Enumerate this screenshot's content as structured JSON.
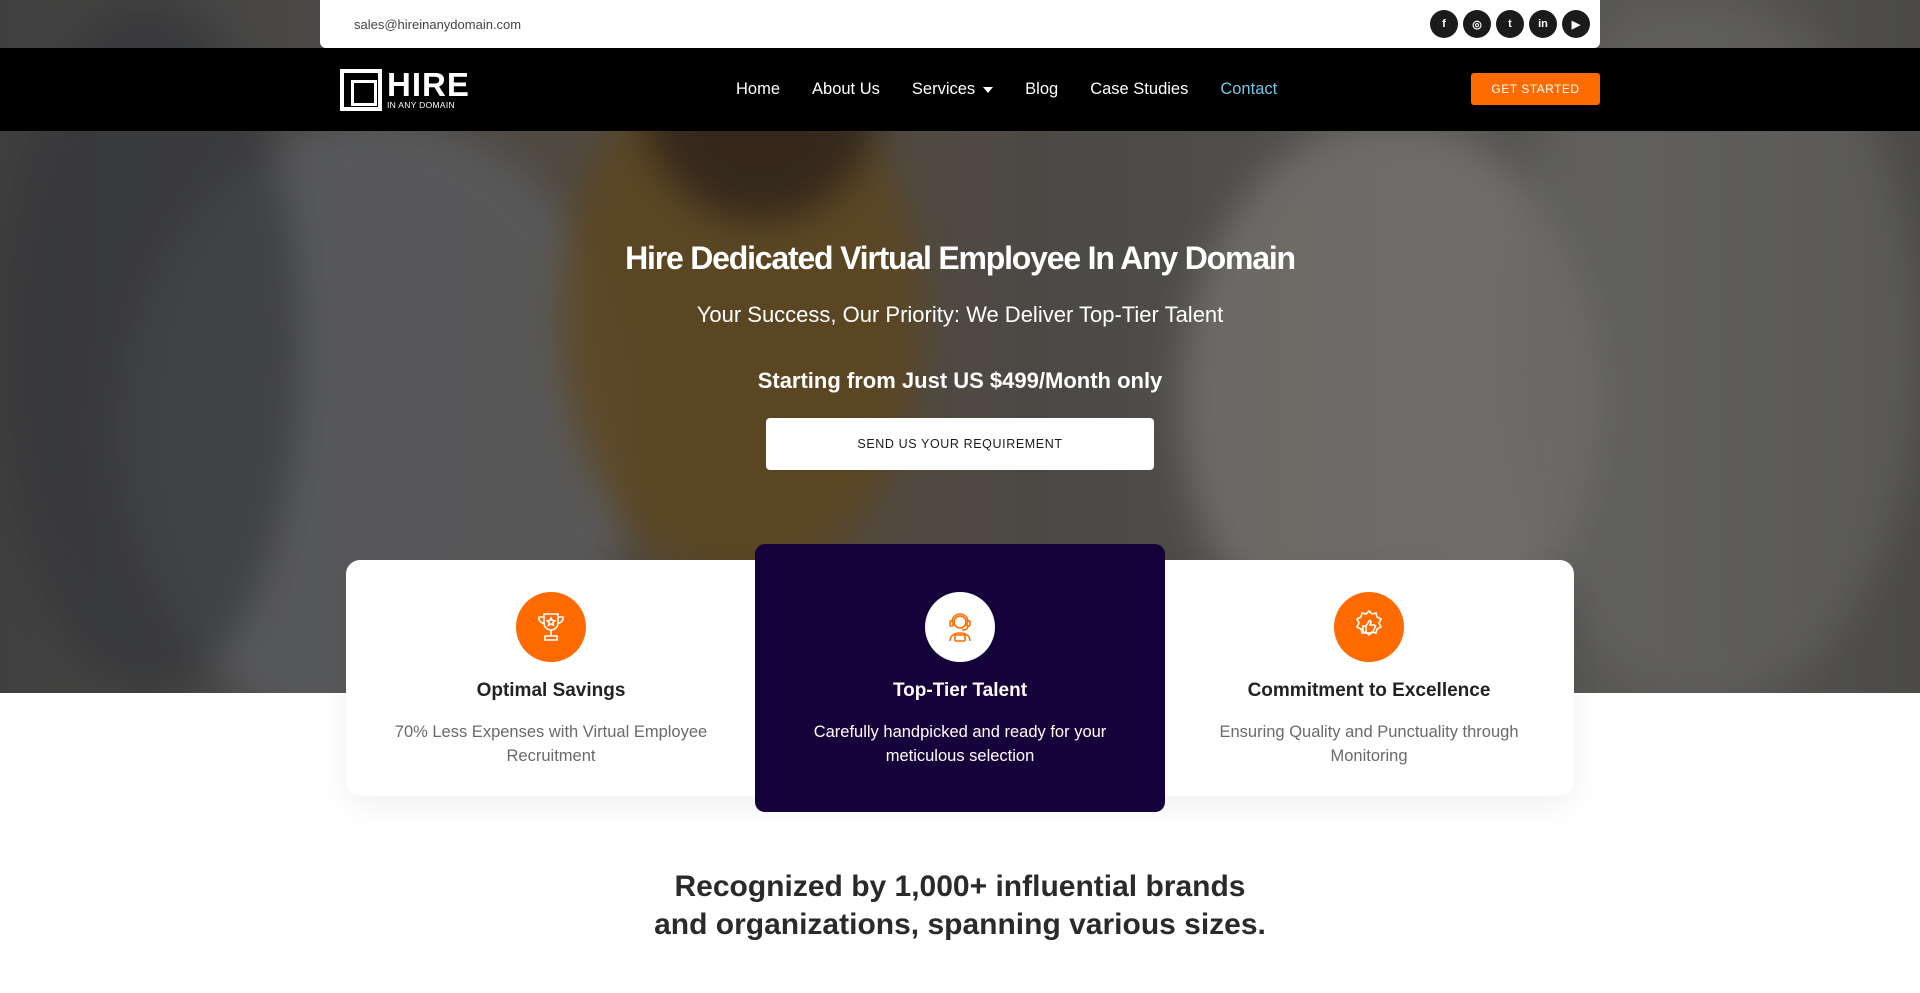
{
  "topbar": {
    "email": "sales@hireinanydomain.com",
    "socials": [
      {
        "name": "facebook",
        "glyph": "f"
      },
      {
        "name": "instagram",
        "glyph": "◎"
      },
      {
        "name": "twitter",
        "glyph": "t"
      },
      {
        "name": "linkedin",
        "glyph": "in"
      },
      {
        "name": "youtube",
        "glyph": "▶"
      }
    ]
  },
  "nav": {
    "logo_main": "HIRE",
    "logo_sub": "IN ANY DOMAIN",
    "links": [
      "Home",
      "About Us",
      "Services",
      "Blog",
      "Case Studies",
      "Contact"
    ],
    "cta": "GET STARTED"
  },
  "hero": {
    "title": "Hire Dedicated Virtual Employee In Any Domain",
    "subtitle": "Your Success, Our Priority: We Deliver Top-Tier Talent",
    "price": "Starting from Just US $499/Month only",
    "button": "SEND US YOUR REQUIREMENT"
  },
  "features": [
    {
      "icon": "trophy-icon",
      "title": "Optimal Savings",
      "desc": "70% Less Expenses with Virtual Employee Recruitment"
    },
    {
      "icon": "support-agent-icon",
      "title": "Top-Tier Talent",
      "desc": "Carefully handpicked and ready for your meticulous selection"
    },
    {
      "icon": "badge-thumbs-up-icon",
      "title": "Commitment to Excellence",
      "desc": "Ensuring Quality and Punctuality through Monitoring"
    }
  ],
  "recognition": {
    "line1": "Recognized by 1,000+ influential brands",
    "line2": "and organizations, spanning various sizes."
  },
  "colors": {
    "accent": "#ff6b00",
    "dark_card": "#15023a",
    "nav_bg": "#000000",
    "contact_link": "#73c7e8"
  }
}
